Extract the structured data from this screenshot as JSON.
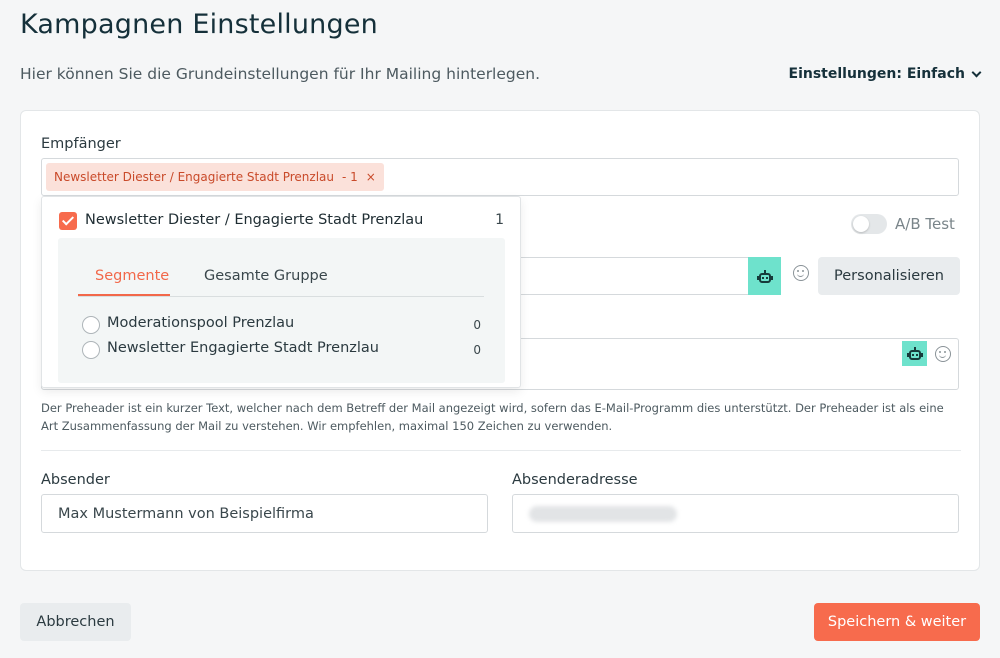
{
  "header": {
    "title": "Kampagnen Einstellungen",
    "subtitle": "Hier können Sie die Grundeinstellungen für Ihr Mailing hinterlegen.",
    "settings_mode": "Einstellungen: Einfach"
  },
  "recipients": {
    "label": "Empfänger",
    "tag_text": "Newsletter Diester / Engagierte Stadt Prenzlau",
    "tag_count": "- 1",
    "tag_remove": "×"
  },
  "ab_test": {
    "label": "A/B Test",
    "enabled": false
  },
  "subject": {
    "personalize_label": "Personalisieren"
  },
  "preheader": {
    "help_text": "Der Preheader ist ein kurzer Text, welcher nach dem Betreff der Mail angezeigt wird, sofern das E-Mail-Programm dies unterstützt. Der Preheader ist als eine Art Zusammenfassung der Mail zu verstehen. Wir empfehlen, maximal 150 Zeichen zu verwenden."
  },
  "sender": {
    "label": "Absender",
    "value": "Max Mustermann von Beispielfirma",
    "address_label": "Absenderadresse"
  },
  "dropdown": {
    "group_title": "Newsletter Diester / Engagierte Stadt Prenzlau",
    "group_count": "1",
    "tabs": [
      {
        "label": "Segmente",
        "active": true
      },
      {
        "label": "Gesamte Gruppe",
        "active": false
      }
    ],
    "segments": [
      {
        "label": "Moderationspool Prenzlau",
        "count": "0"
      },
      {
        "label": "Newsletter Engagierte Stadt Prenzlau",
        "count": "0"
      }
    ]
  },
  "footer": {
    "cancel_label": "Abbrechen",
    "save_label": "Speichern & weiter"
  },
  "colors": {
    "accent": "#f76b4d",
    "robot_bg": "#6ee2cc",
    "tag_bg": "#fbe1da"
  },
  "icons": [
    "chevron-down-icon",
    "close-icon",
    "robot-icon",
    "emoji-icon",
    "checkbox-checked-icon",
    "radio-icon"
  ]
}
